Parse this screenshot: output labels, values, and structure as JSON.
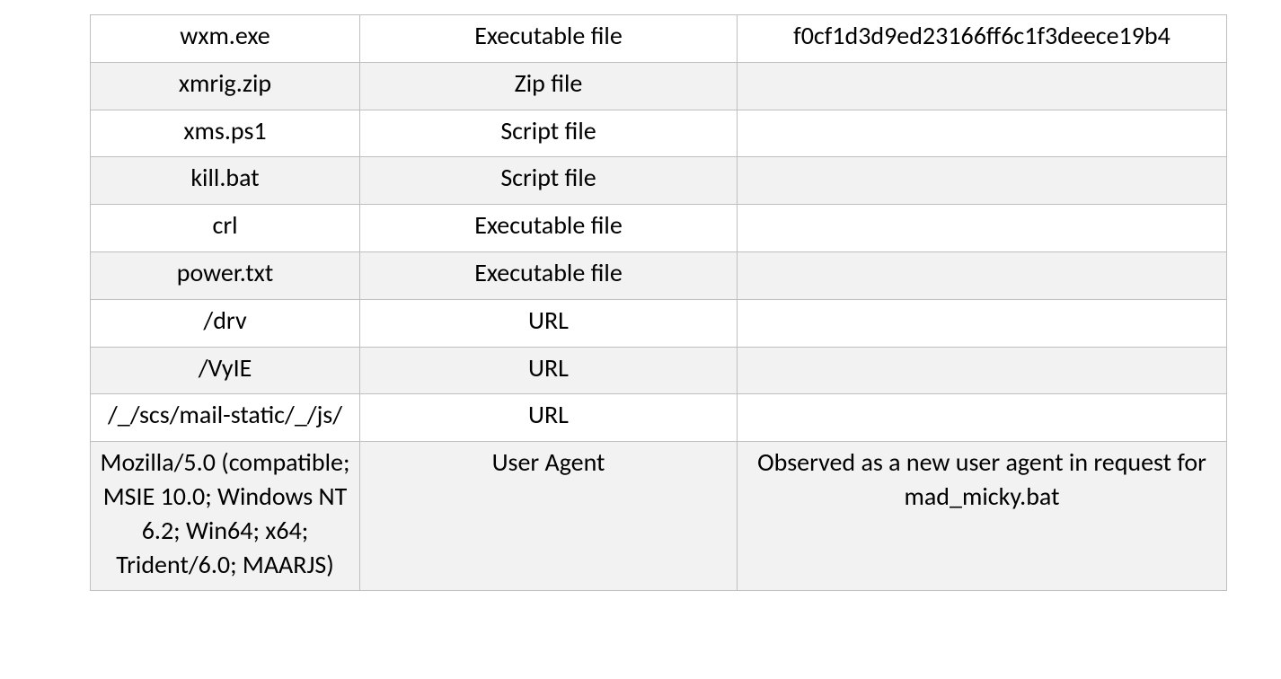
{
  "table": {
    "rows": [
      {
        "indicator": "wxm.exe",
        "type": "Executable file",
        "note": "f0cf1d3d9ed23166ff6c1f3deece19b4"
      },
      {
        "indicator": "xmrig.zip",
        "type": "Zip file",
        "note": ""
      },
      {
        "indicator": "xms.ps1",
        "type": "Script file",
        "note": ""
      },
      {
        "indicator": "kill.bat",
        "type": "Script file",
        "note": ""
      },
      {
        "indicator": "crl",
        "type": "Executable file",
        "note": ""
      },
      {
        "indicator": "power.txt",
        "type": "Executable file",
        "note": ""
      },
      {
        "indicator": "/drv",
        "type": "URL",
        "note": ""
      },
      {
        "indicator": "/VyIE",
        "type": "URL",
        "note": ""
      },
      {
        "indicator": "/_/scs/mail-static/_/js/",
        "type": "URL",
        "note": ""
      },
      {
        "indicator": "Mozilla/5.0 (compatible; MSIE 10.0; Windows NT 6.2; Win64; x64; Trident/6.0; MAARJS)",
        "type": "User Agent",
        "note": "Observed as a new user agent in request for mad_micky.bat"
      }
    ]
  }
}
